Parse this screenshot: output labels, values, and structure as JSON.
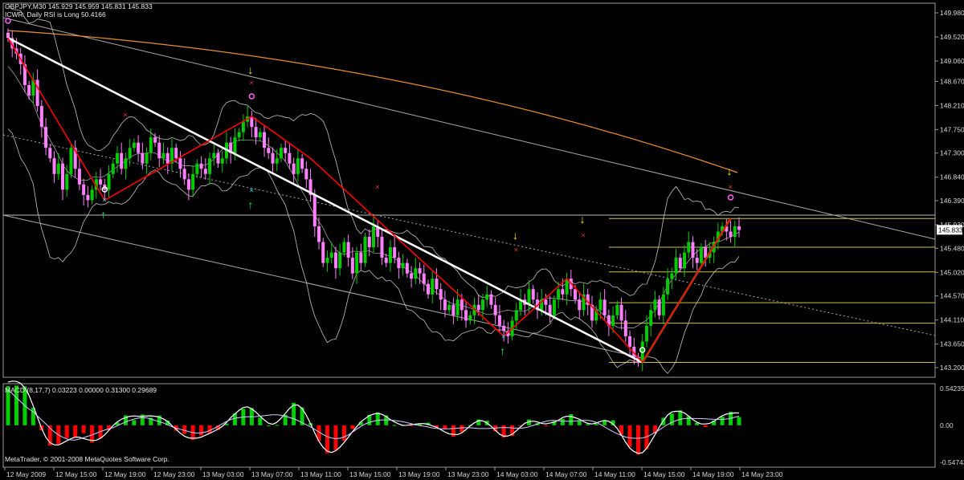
{
  "header": {
    "line1": "GBPJPY,M30  145.929 145.959 145.831 145.833",
    "line2": "ICWR: Daily RSI is Long 50.4166"
  },
  "copyright": "MetaTrader, © 2001-2008 MetaQuotes Software Corp.",
  "colors": {
    "bull": "#00cc00",
    "bear": "#ff80ff",
    "bullWick": "#00cc00",
    "bearWick": "#ff80ff",
    "zigzag": "#ff0000",
    "trend": "#ffffff",
    "fib": "#d2c04a",
    "orange": "#e8902f",
    "bands": "#c0c0c0",
    "histPos": "#00d000",
    "histNeg": "#ff0000"
  },
  "chart_data": [
    {
      "type": "candlestick",
      "title": "GBPJPY,M30",
      "ylim": [
        143.2,
        149.98
      ],
      "yticks": [
        "149.980",
        "149.520",
        "149.060",
        "148.670",
        "148.210",
        "147.750",
        "147.300",
        "146.840",
        "146.390",
        "145.930",
        "145.833",
        "145.480",
        "145.020",
        "144.570",
        "144.110",
        "143.650",
        "143.200"
      ],
      "price_label": "145.833",
      "xticks": [
        "12 May 2009",
        "12 May 15:00",
        "12 May 19:00",
        "12 May 23:00",
        "13 May 03:00",
        "13 May 07:00",
        "13 May 11:00",
        "13 May 15:00",
        "13 May 19:00",
        "13 May 23:00",
        "14 May 03:00",
        "14 May 07:00",
        "14 May 11:00",
        "14 May 15:00",
        "14 May 19:00",
        "14 May 23:00"
      ],
      "fib_levels": [
        146.05,
        145.5,
        145.03,
        144.44,
        144.05,
        143.3
      ],
      "zigzag": [
        [
          0,
          149.5
        ],
        [
          23,
          146.4
        ],
        [
          58,
          148.0
        ],
        [
          72,
          147.2
        ],
        [
          118,
          143.8
        ],
        [
          133,
          144.9
        ],
        [
          151,
          143.3
        ],
        [
          172,
          146.05
        ]
      ],
      "close": [
        149.5,
        149.3,
        149.2,
        149.0,
        148.6,
        148.4,
        148.7,
        148.2,
        147.8,
        147.4,
        147.2,
        146.9,
        147.1,
        146.6,
        146.9,
        147.4,
        147.0,
        146.7,
        146.5,
        146.4,
        146.6,
        146.8,
        146.7,
        146.6,
        146.9,
        147.1,
        147.3,
        147.0,
        147.2,
        147.4,
        147.5,
        147.3,
        147.1,
        147.3,
        147.6,
        147.5,
        147.2,
        147.3,
        147.1,
        147.4,
        147.2,
        147.0,
        146.8,
        146.6,
        146.9,
        147.1,
        147.0,
        146.9,
        147.2,
        147.3,
        147.1,
        147.2,
        147.5,
        147.3,
        147.6,
        147.7,
        147.9,
        148.0,
        147.8,
        147.6,
        147.7,
        147.4,
        147.3,
        147.1,
        147.2,
        147.4,
        147.3,
        147.1,
        146.9,
        147.2,
        147.0,
        146.8,
        146.5,
        145.9,
        145.6,
        145.2,
        145.3,
        145.4,
        145.1,
        145.4,
        145.6,
        145.3,
        145.0,
        145.4,
        145.2,
        145.7,
        145.5,
        145.9,
        145.7,
        145.3,
        145.2,
        145.5,
        145.3,
        145.1,
        145.2,
        145.0,
        144.9,
        145.1,
        145.0,
        144.8,
        144.6,
        144.9,
        144.7,
        144.5,
        144.3,
        144.4,
        144.2,
        144.5,
        144.3,
        144.1,
        144.2,
        144.4,
        144.3,
        144.5,
        144.6,
        144.4,
        144.2,
        144.0,
        143.9,
        143.8,
        144.1,
        144.3,
        144.5,
        144.4,
        144.7,
        144.5,
        144.3,
        144.5,
        144.4,
        144.2,
        144.5,
        144.7,
        144.6,
        144.9,
        144.7,
        144.5,
        144.3,
        144.6,
        144.4,
        144.1,
        144.3,
        144.5,
        144.2,
        144.0,
        144.2,
        144.4,
        144.1,
        143.8,
        143.6,
        143.4,
        143.3,
        143.7,
        144.0,
        144.3,
        144.5,
        144.2,
        144.6,
        144.9,
        145.0,
        145.3,
        145.1,
        145.4,
        145.6,
        145.3,
        145.2,
        145.5,
        145.3,
        145.4,
        145.6,
        145.8,
        145.9,
        145.8,
        145.7,
        145.9,
        145.83
      ]
    },
    {
      "type": "bar",
      "title": "MACD (8,17,7) 0.03223 0.00000 0.31300 0.29689",
      "ylim": [
        -0.54743,
        0.54235
      ],
      "yticks": [
        "0.54235",
        "0.00",
        "-0.54743"
      ]
    }
  ]
}
